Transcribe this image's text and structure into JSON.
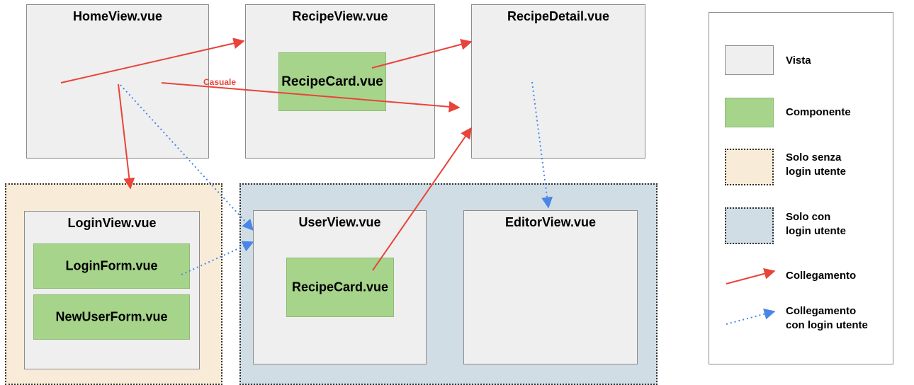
{
  "colors": {
    "view": "#efefef",
    "component": "#a7d48b",
    "zone_no_login": "#f8ecd8",
    "zone_login": "#d1dde5",
    "link": "#e8443a",
    "login_link": "#4a86e8"
  },
  "views": {
    "home": "HomeView.vue",
    "recipe": "RecipeView.vue",
    "recipe_detail": "RecipeDetail.vue",
    "login": "LoginView.vue",
    "user": "UserView.vue",
    "editor": "EditorView.vue"
  },
  "components": {
    "recipe_card_top": "RecipeCard.vue",
    "login_form": "LoginForm.vue",
    "new_user_form": "NewUserForm.vue",
    "recipe_card_user": "RecipeCard.vue"
  },
  "edge_labels": {
    "random": "Casuale"
  },
  "legend": {
    "view": "Vista",
    "component": "Componente",
    "no_login_line1": "Solo senza",
    "no_login_line2": "login utente",
    "login_line1": "Solo con",
    "login_line2": "login utente",
    "link": "Collegamento",
    "login_link_line1": "Collegamento",
    "login_link_line2": "con login utente"
  }
}
